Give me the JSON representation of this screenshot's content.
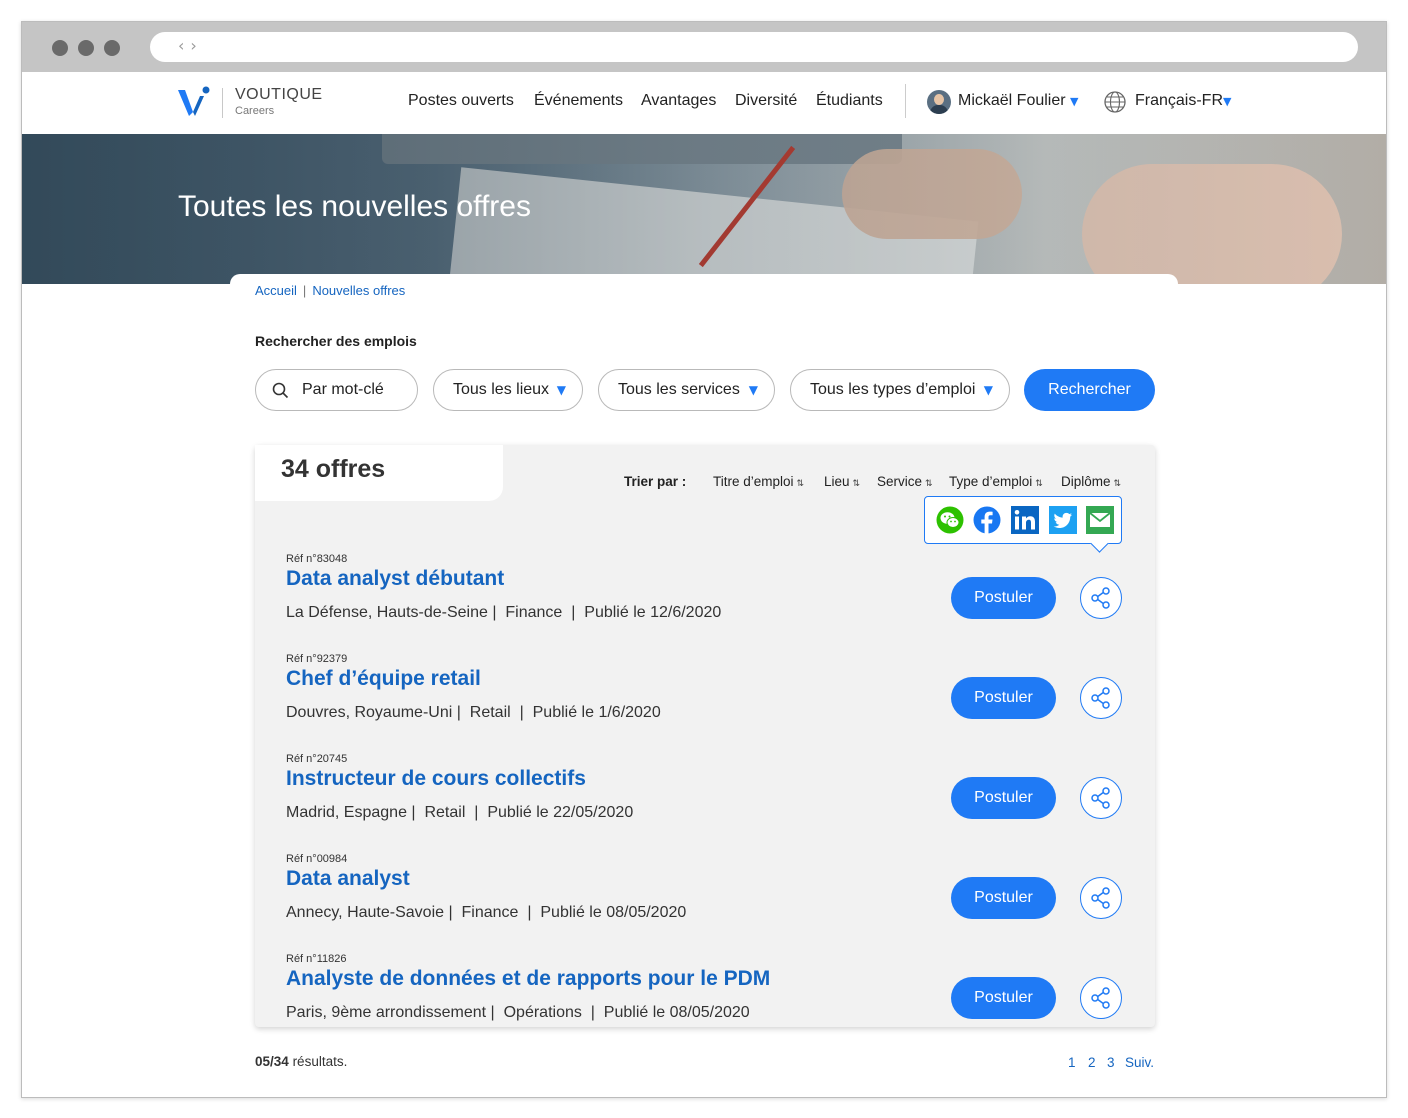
{
  "header": {
    "brand": "VOUTIQUE",
    "brand_sub": "Careers",
    "nav": [
      "Postes ouverts",
      "Événements",
      "Avantages",
      "Diversité",
      "Étudiants"
    ],
    "user_name": "Mickaël Foulier",
    "language": "Français-FR",
    "accent": "#1f7af5"
  },
  "hero": {
    "title": "Toutes les nouvelles offres"
  },
  "breadcrumb": [
    "Accueil",
    "Nouvelles offres"
  ],
  "search": {
    "label": "Rechercher des emplois",
    "keyword_placeholder": "Par mot-clé",
    "location": "Tous les lieux",
    "service": "Tous les services",
    "job_type": "Tous les types d’emploi",
    "button": "Rechercher"
  },
  "results": {
    "count": "34 offres",
    "sort_label": "Trier par :",
    "sort_fields": [
      "Titre d’emploi",
      "Lieu",
      "Service",
      "Type d’emploi",
      "Diplôme"
    ],
    "share_icons": [
      "wechat-icon",
      "facebook-icon",
      "linkedin-icon",
      "twitter-icon",
      "email-icon"
    ],
    "apply_label": "Postuler",
    "jobs": [
      {
        "ref": "Réf n°83048",
        "title": "Data analyst débutant",
        "location": "La Défense, Hauts-de-Seine",
        "service": "Finance",
        "date": "Publié le 12/6/2020"
      },
      {
        "ref": "Réf n°92379",
        "title": "Chef d’équipe retail",
        "location": "Douvres, Royaume-Uni",
        "service": "Retail",
        "date": "Publié le 1/6/2020"
      },
      {
        "ref": "Réf n°20745",
        "title": "Instructeur de cours collectifs",
        "location": "Madrid, Espagne",
        "service": "Retail",
        "date": "Publié le 22/05/2020"
      },
      {
        "ref": "Réf n°00984",
        "title": "Data analyst",
        "location": "Annecy, Haute-Savoie",
        "service": "Finance",
        "date": "Publié le 08/05/2020"
      },
      {
        "ref": "Réf n°11826",
        "title": "Analyste de données et de rapports pour le PDM",
        "location": "Paris, 9ème arrondissement",
        "service": "Opérations",
        "date": "Publié le 08/05/2020"
      }
    ]
  },
  "footer": {
    "shown": "05/34",
    "shown_suffix": "résultats.",
    "pages": [
      "1",
      "2",
      "3"
    ],
    "next": "Suiv."
  }
}
